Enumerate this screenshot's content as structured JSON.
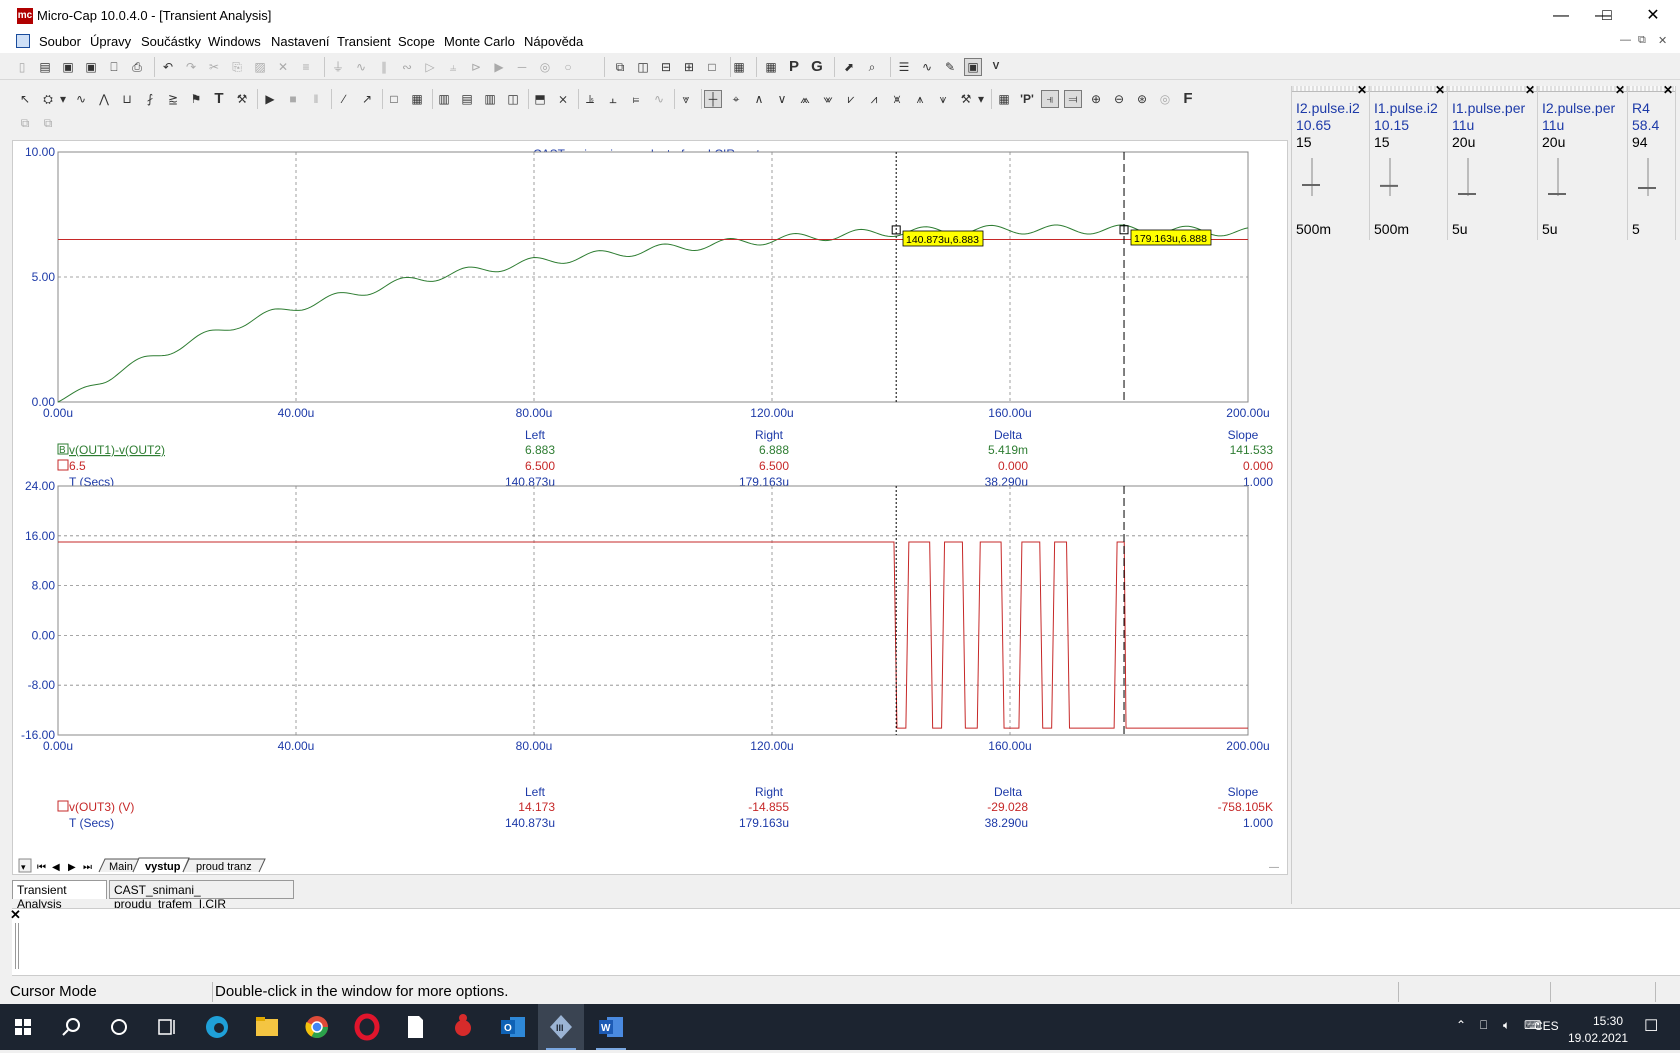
{
  "window": {
    "title": "Micro-Cap 10.0.4.0 - [Transient Analysis]",
    "app_icon": "mc"
  },
  "menu": [
    "Soubor",
    "Úpravy",
    "Součástky",
    "Windows",
    "Nastavení",
    "Transient",
    "Scope",
    "Monte Carlo",
    "Nápověda"
  ],
  "plot_title": "CAST_snimani_ proudu_trafem_I.CIR vystup",
  "cursor_tags": [
    "140.873u,6.883",
    "179.163u,6.888"
  ],
  "plot1": {
    "y_ticks": [
      "10.00",
      "5.00",
      "0.00"
    ],
    "x_ticks": [
      "0.00u",
      "40.00u",
      "80.00u",
      "120.00u",
      "160.00u",
      "200.00u"
    ],
    "headers": [
      "Left",
      "Right",
      "Delta",
      "Slope"
    ],
    "rows": [
      {
        "label": "v(OUT1)-v(OUT2)",
        "prefix": "B",
        "vals": [
          "6.883",
          "6.888",
          "5.419m",
          "141.533"
        ],
        "color": "#2e7d32"
      },
      {
        "label": "6.5",
        "prefix": "",
        "vals": [
          "6.500",
          "6.500",
          "0.000",
          "0.000"
        ],
        "color": "#c62828"
      },
      {
        "label": "T (Secs)",
        "prefix": "",
        "vals": [
          "140.873u",
          "179.163u",
          "38.290u",
          "1.000"
        ],
        "color": "#1d3aa8"
      }
    ]
  },
  "plot2": {
    "y_ticks": [
      "24.00",
      "16.00",
      "8.00",
      "0.00",
      "-8.00",
      "-16.00"
    ],
    "x_ticks": [
      "0.00u",
      "40.00u",
      "80.00u",
      "120.00u",
      "160.00u",
      "200.00u"
    ],
    "headers": [
      "Left",
      "Right",
      "Delta",
      "Slope"
    ],
    "rows": [
      {
        "label": "v(OUT3) (V)",
        "prefix": "",
        "vals": [
          "14.173",
          "-14.855",
          "-29.028",
          "-758.105K"
        ],
        "color": "#c62828"
      },
      {
        "label": "T (Secs)",
        "prefix": "",
        "vals": [
          "140.873u",
          "179.163u",
          "38.290u",
          "1.000"
        ],
        "color": "#1d3aa8"
      }
    ]
  },
  "page_tabs": [
    "Main",
    "vystup",
    "proud tranz"
  ],
  "analysis_tabs": [
    "Transient Analysis",
    "CAST_snimani_ proudu_trafem_I.CIR"
  ],
  "sliders": [
    {
      "name": "I2.pulse.i2",
      "value": "10.65",
      "max": "15",
      "min": "500m",
      "level": 0.7
    },
    {
      "name": "I1.pulse.i2",
      "value": "10.15",
      "max": "15",
      "min": "500m",
      "level": 0.67
    },
    {
      "name": "I1.pulse.per",
      "value": "11u",
      "max": "20u",
      "min": "5u",
      "level": 0.4
    },
    {
      "name": "I2.pulse.per",
      "value": "11u",
      "max": "20u",
      "min": "5u",
      "level": 0.4
    },
    {
      "name": "R4",
      "value": "58.4",
      "max": "94",
      "min": "5",
      "level": 0.6
    }
  ],
  "status": {
    "mode": "Cursor Mode",
    "hint": "Double-click in the window for more options."
  },
  "tray": {
    "lang": "CES",
    "time": "15:30",
    "date": "19.02.2021"
  },
  "colors": {
    "curve_green": "#2e7d32",
    "curve_red": "#c62828",
    "axis_blue": "#1d3aa8",
    "tag_yellow": "#ffff00"
  },
  "chart_data": [
    {
      "type": "line",
      "xlabel": "T (Secs)",
      "ylim": [
        0,
        10
      ],
      "xlim": [
        0,
        200
      ],
      "x_unit": "u",
      "grid": true,
      "series": [
        {
          "name": "v(OUT1)-v(OUT2)",
          "x": [
            0,
            10,
            20,
            30,
            40,
            60,
            80,
            100,
            120,
            140,
            160,
            180,
            200
          ],
          "values": [
            0,
            1.2,
            2.2,
            3.1,
            3.8,
            4.9,
            5.6,
            6.1,
            6.5,
            6.8,
            6.9,
            6.9,
            6.8
          ]
        },
        {
          "name": "6.5",
          "x": [
            0,
            200
          ],
          "values": [
            6.5,
            6.5
          ]
        }
      ]
    },
    {
      "type": "line",
      "xlabel": "T (Secs)",
      "ylim": [
        -16,
        24
      ],
      "xlim": [
        0,
        200
      ],
      "x_unit": "u",
      "grid": true,
      "series": [
        {
          "name": "v(OUT3) (V)",
          "x": [
            0,
            140.5,
            141,
            142.5,
            143,
            146.5,
            147,
            148.5,
            149,
            152,
            152.5,
            154.5,
            155,
            158.5,
            159,
            161.5,
            162,
            165,
            165.5,
            167,
            167.5,
            169.5,
            170,
            177.5,
            178,
            179.2,
            179.5,
            200
          ],
          "values": [
            15,
            15,
            -14.9,
            -14.9,
            15,
            15,
            -14.9,
            -14.9,
            15,
            15,
            -14.9,
            -14.9,
            15,
            15,
            -14.9,
            -14.9,
            15,
            15,
            -14.9,
            -14.9,
            15,
            15,
            -14.9,
            -14.9,
            15,
            15,
            -14.9,
            -14.9
          ]
        }
      ]
    }
  ]
}
